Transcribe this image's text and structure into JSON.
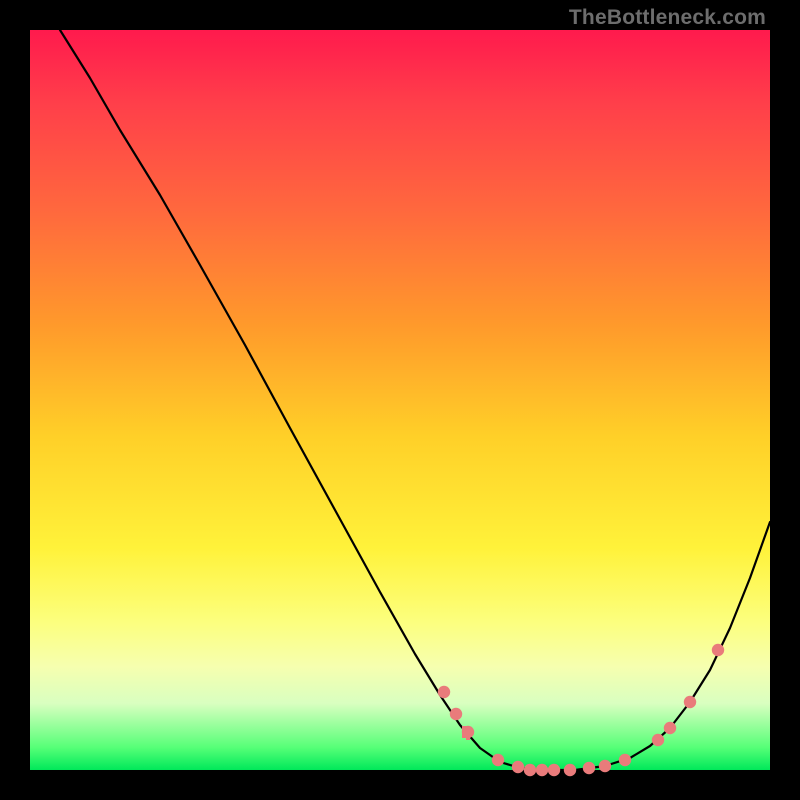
{
  "watermark": "TheBottleneck.com",
  "chart_data": {
    "type": "line",
    "title": "",
    "xlabel": "",
    "ylabel": "",
    "xlim": [
      0,
      740
    ],
    "ylim": [
      0,
      740
    ],
    "curve": [
      [
        30,
        0
      ],
      [
        60,
        48
      ],
      [
        90,
        100
      ],
      [
        130,
        165
      ],
      [
        170,
        235
      ],
      [
        215,
        315
      ],
      [
        260,
        398
      ],
      [
        305,
        480
      ],
      [
        350,
        562
      ],
      [
        385,
        624
      ],
      [
        410,
        665
      ],
      [
        430,
        695
      ],
      [
        450,
        718
      ],
      [
        470,
        732
      ],
      [
        490,
        738
      ],
      [
        515,
        740
      ],
      [
        545,
        740
      ],
      [
        575,
        736
      ],
      [
        600,
        728
      ],
      [
        620,
        716
      ],
      [
        640,
        698
      ],
      [
        660,
        672
      ],
      [
        680,
        640
      ],
      [
        700,
        598
      ],
      [
        720,
        548
      ],
      [
        740,
        492
      ]
    ],
    "dots": [
      [
        414,
        662
      ],
      [
        426,
        684
      ],
      [
        438,
        702
      ],
      [
        468,
        730
      ],
      [
        488,
        737
      ],
      [
        500,
        740
      ],
      [
        512,
        740
      ],
      [
        524,
        740
      ],
      [
        540,
        740
      ],
      [
        559,
        738
      ],
      [
        575,
        736
      ],
      [
        595,
        730
      ],
      [
        628,
        710
      ],
      [
        640,
        698
      ],
      [
        660,
        672
      ],
      [
        688,
        620
      ]
    ],
    "ticks": [
      [
        432,
        696,
        4,
        12
      ],
      [
        436,
        700,
        4,
        10
      ]
    ]
  }
}
